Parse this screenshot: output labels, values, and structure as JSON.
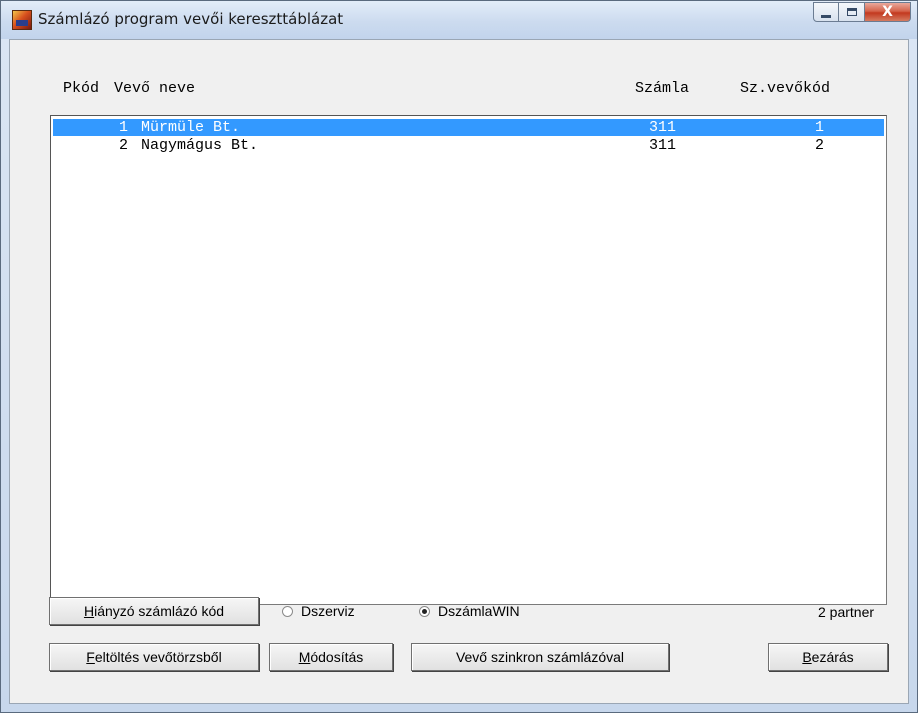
{
  "window": {
    "title": "Számlázó program vevői kereszttáblázat",
    "close_glyph": "X"
  },
  "columns": {
    "code": "Pkód",
    "name": "Vevő neve",
    "invoice": "Számla",
    "customer_code": "Sz.vevőkód"
  },
  "rows": [
    {
      "code": "1",
      "name": "Mürmüle Bt.",
      "invoice": "311",
      "customer_code": "1",
      "selected": true
    },
    {
      "code": "2",
      "name": "Nagymágus Bt.",
      "invoice": "311",
      "customer_code": "2",
      "selected": false
    }
  ],
  "buttons": {
    "missing_code_hotkey": "H",
    "missing_code_rest": "iányzó számlázó kód",
    "fill_hotkey": "F",
    "fill_rest": "eltöltés vevőtörzsből",
    "modify_hotkey": "M",
    "modify_rest": "ódosítás",
    "sync": "Vevő szinkron számlázóval",
    "close_hotkey": "B",
    "close_rest": "ezárás"
  },
  "radios": {
    "dszerviz": {
      "label": "Dszerviz",
      "checked": false
    },
    "dszamlawin": {
      "label": "DszámlaWIN",
      "checked": true
    }
  },
  "status": {
    "partner_count": "2 partner"
  },
  "colors": {
    "selection": "#3399ff",
    "face": "#f0f0f0"
  }
}
